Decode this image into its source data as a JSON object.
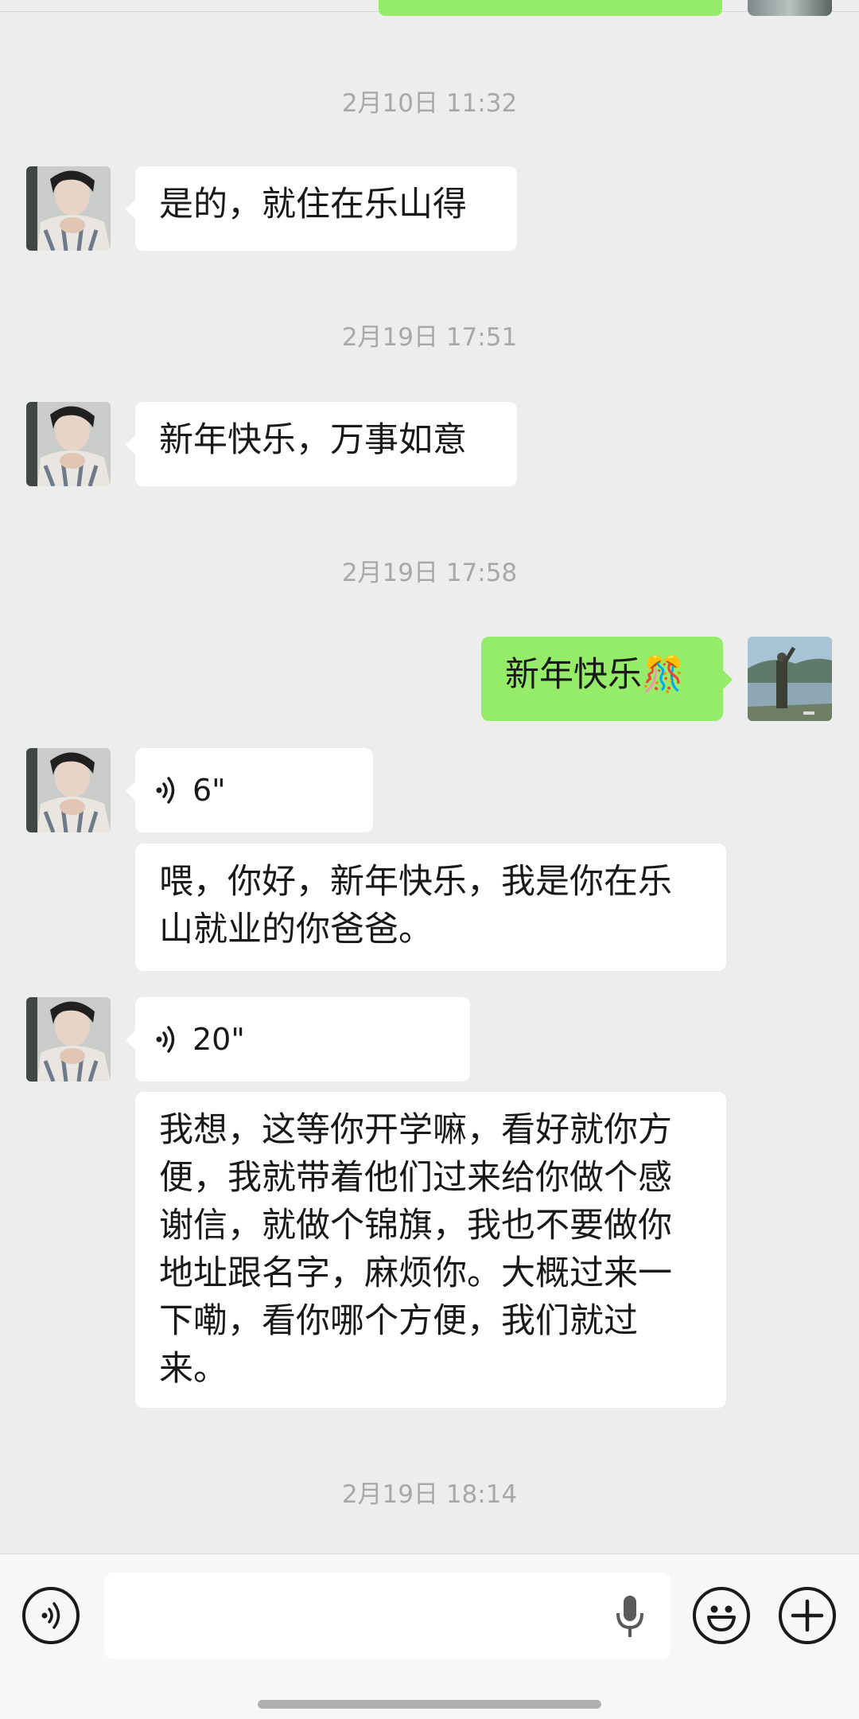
{
  "messages": {
    "t1": "2月10日 11:32",
    "m1": "是的，就住在乐山得",
    "t2": "2月19日 17:51",
    "m2": "新年快乐，万事如意",
    "t3": "2月19日 17:58",
    "m3": "新年快乐",
    "m3_emoji": "🎊",
    "v1_duration": "6\"",
    "v1_transcript": "喂，你好，新年快乐，我是你在乐山就业的你爸爸。",
    "v2_duration": "20\"",
    "v2_transcript": "我想，这等你开学嘛，看好就你方便，我就带着他们过来给你做个感谢信，就做个锦旗，我也不要做你地址跟名字，麻烦你。大概过来一下嘞，看你哪个方便，我们就过来。",
    "t4": "2月19日 18:14"
  },
  "icons": {
    "voice_toggle": "voice-mode-icon",
    "mic": "microphone-icon",
    "emoji": "emoji-face-icon",
    "plus": "plus-icon",
    "voice_playback": "voice-wave-icon"
  },
  "colors": {
    "background": "#ededed",
    "incoming_bubble": "#ffffff",
    "outgoing_bubble": "#95ec69",
    "timestamp": "#a8a8a8"
  }
}
